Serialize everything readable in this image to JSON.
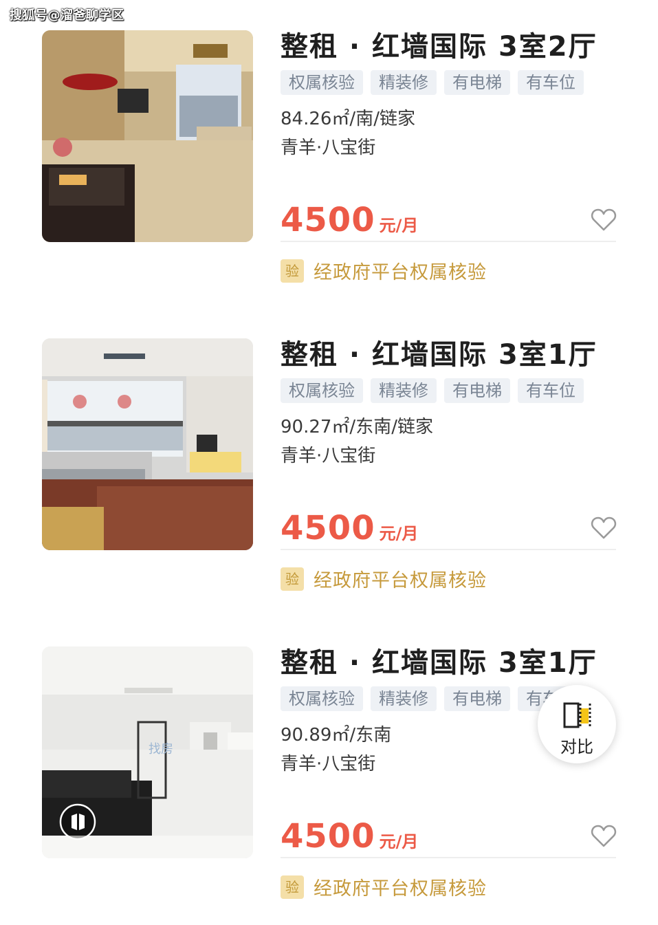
{
  "watermark": "搜狐号@溜爸聊学区",
  "compare": {
    "label": "对比",
    "icon": "compare-icon"
  },
  "listings": [
    {
      "title": "整租 · 红墙国际 3室2厅",
      "tags": [
        "权属核验",
        "精装修",
        "有电梯",
        "有车位"
      ],
      "area_line": "84.26㎡/南/链家",
      "location": "青羊·八宝街",
      "price": "4500",
      "price_unit": "元/月",
      "verify_badge": "验",
      "verify_text": "经政府平台权属核验",
      "photo": "living-room-photo"
    },
    {
      "title": "整租 · 红墙国际 3室1厅",
      "tags": [
        "权属核验",
        "精装修",
        "有电梯",
        "有车位"
      ],
      "area_line": "90.27㎡/东南/链家",
      "location": "青羊·八宝街",
      "price": "4500",
      "price_unit": "元/月",
      "verify_badge": "验",
      "verify_text": "经政府平台权属核验",
      "photo": "living-room-photo"
    },
    {
      "title": "整租 · 红墙国际 3室1厅",
      "tags": [
        "权属核验",
        "精装修",
        "有电梯",
        "有车位"
      ],
      "area_line": "90.89㎡/东南",
      "location": "青羊·八宝街",
      "price": "4500",
      "price_unit": "元/月",
      "verify_badge": "验",
      "verify_text": "经政府平台权属核验",
      "photo": "living-room-photo",
      "photo_overlay_text": "找房",
      "vr_icon": "vr-play-icon"
    }
  ],
  "colors": {
    "price": "#ec5a47",
    "verify_text": "#c69a3c",
    "verify_badge_bg": "#f4dfa8",
    "tag_bg": "#eef1f5",
    "tag_text": "#7a8594"
  }
}
